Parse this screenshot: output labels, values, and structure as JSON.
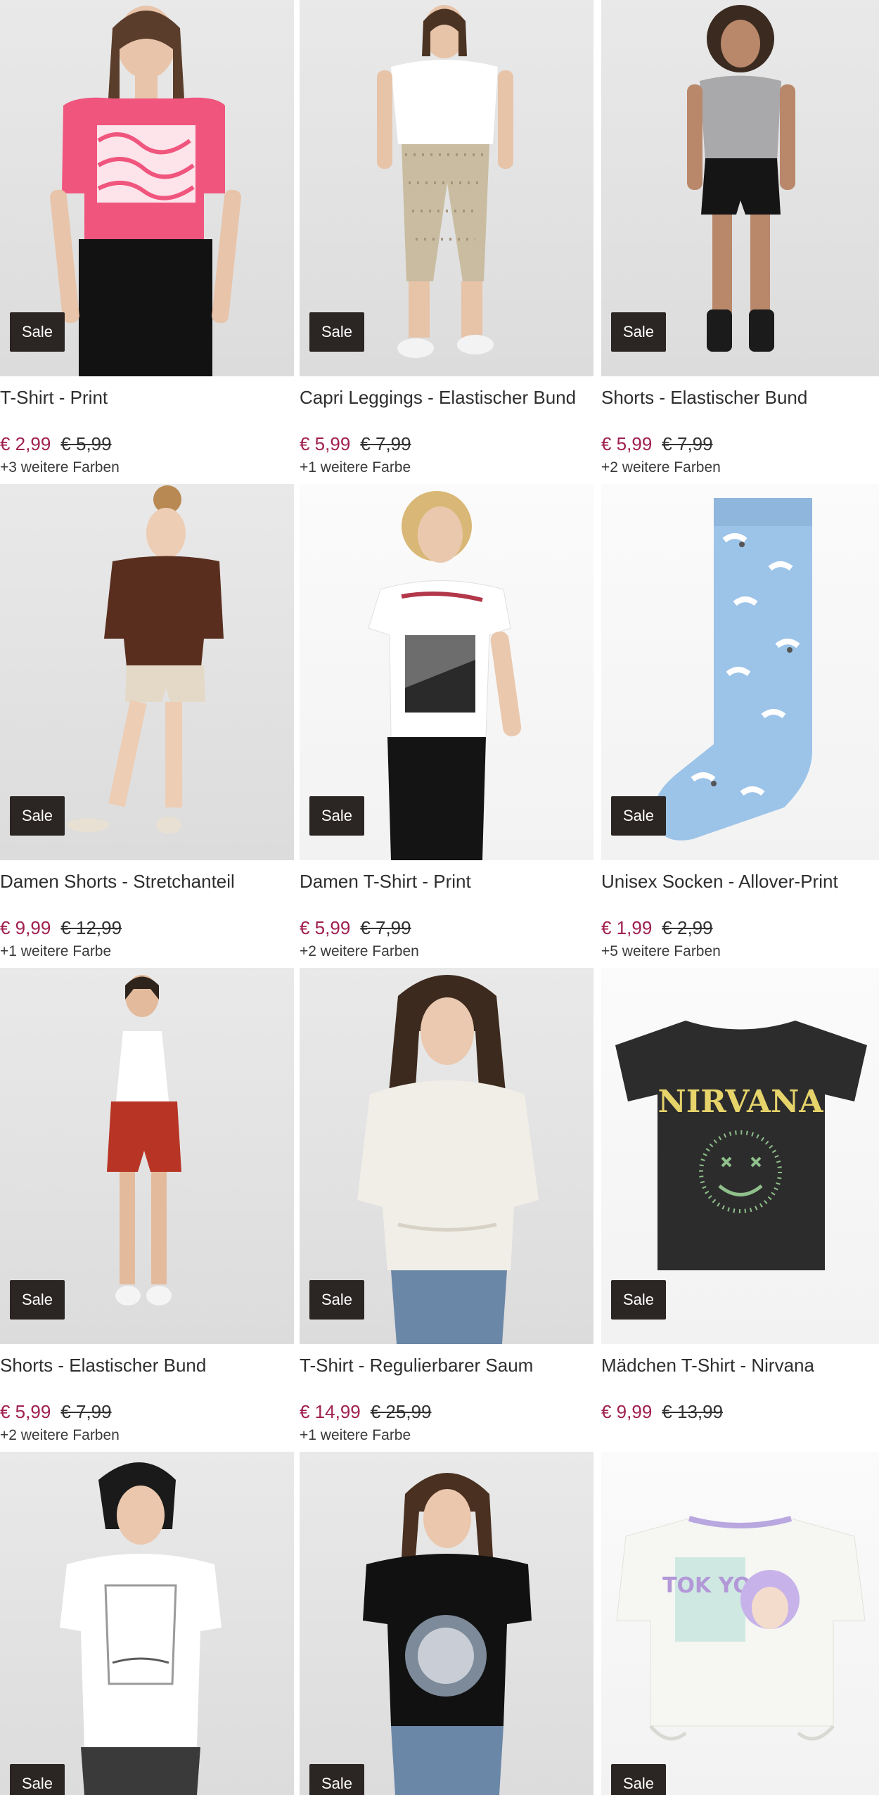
{
  "products": [
    {
      "title": "T-Shirt - Print",
      "price": "€ 2,99",
      "old_price": "€ 5,99",
      "colors": "+3 weitere Farben",
      "badge": "Sale",
      "image": "model-pink-tshirt",
      "accent": "#f0557e"
    },
    {
      "title": "Capri Leggings - Elastischer Bund",
      "price": "€ 5,99",
      "old_price": "€ 7,99",
      "colors": "+1 weitere Farbe",
      "badge": "Sale",
      "image": "model-leggings",
      "accent": "#c9bca0"
    },
    {
      "title": "Shorts - Elastischer Bund",
      "price": "€ 5,99",
      "old_price": "€ 7,99",
      "colors": "+2 weitere Farben",
      "badge": "Sale",
      "image": "model-black-shorts",
      "accent": "#1c1c1c"
    },
    {
      "title": "Damen Shorts - Stretchanteil",
      "price": "€ 9,99",
      "old_price": "€ 12,99",
      "colors": "+1 weitere Farbe",
      "badge": "Sale",
      "image": "model-beige-shorts",
      "accent": "#e2d8c8"
    },
    {
      "title": "Damen T-Shirt - Print",
      "price": "€ 5,99",
      "old_price": "€ 7,99",
      "colors": "+2 weitere Farben",
      "badge": "Sale",
      "image": "model-print-tshirt",
      "accent": "#ffffff"
    },
    {
      "title": "Unisex Socken - Allover-Print",
      "price": "€ 1,99",
      "old_price": "€ 2,99",
      "colors": "+5 weitere Farben",
      "badge": "Sale",
      "image": "seagull-sock",
      "accent": "#9cc3e8"
    },
    {
      "title": "Shorts - Elastischer Bund",
      "price": "€ 5,99",
      "old_price": "€ 7,99",
      "colors": "+2 weitere Farben",
      "badge": "Sale",
      "image": "model-red-shorts",
      "accent": "#b83425"
    },
    {
      "title": "T-Shirt - Regulierbarer Saum",
      "price": "€ 14,99",
      "old_price": "€ 25,99",
      "colors": "+1 weitere Farbe",
      "badge": "Sale",
      "image": "model-white-tunic",
      "accent": "#f1eee8"
    },
    {
      "title": "Mädchen T-Shirt - Nirvana",
      "price": "€ 9,99",
      "old_price": "€ 13,99",
      "colors": "",
      "badge": "Sale",
      "image": "nirvana-tshirt",
      "accent": "#2c2c2c",
      "print_text": "NIRVANA"
    },
    {
      "title": "",
      "price": "",
      "old_price": "",
      "colors": "",
      "badge": "Sale",
      "image": "model-white-print-tshirt",
      "accent": "#ffffff"
    },
    {
      "title": "",
      "price": "",
      "old_price": "",
      "colors": "",
      "badge": "Sale",
      "image": "model-black-print-tshirt",
      "accent": "#111111"
    },
    {
      "title": "",
      "price": "",
      "old_price": "",
      "colors": "",
      "badge": "Sale",
      "image": "anime-crop-tshirt",
      "accent": "#f6f6f2",
      "print_text": "TOK YO"
    }
  ],
  "colors": {
    "sale_badge": "#2b2523",
    "price": "#a02050",
    "text": "#2e2e2e"
  }
}
